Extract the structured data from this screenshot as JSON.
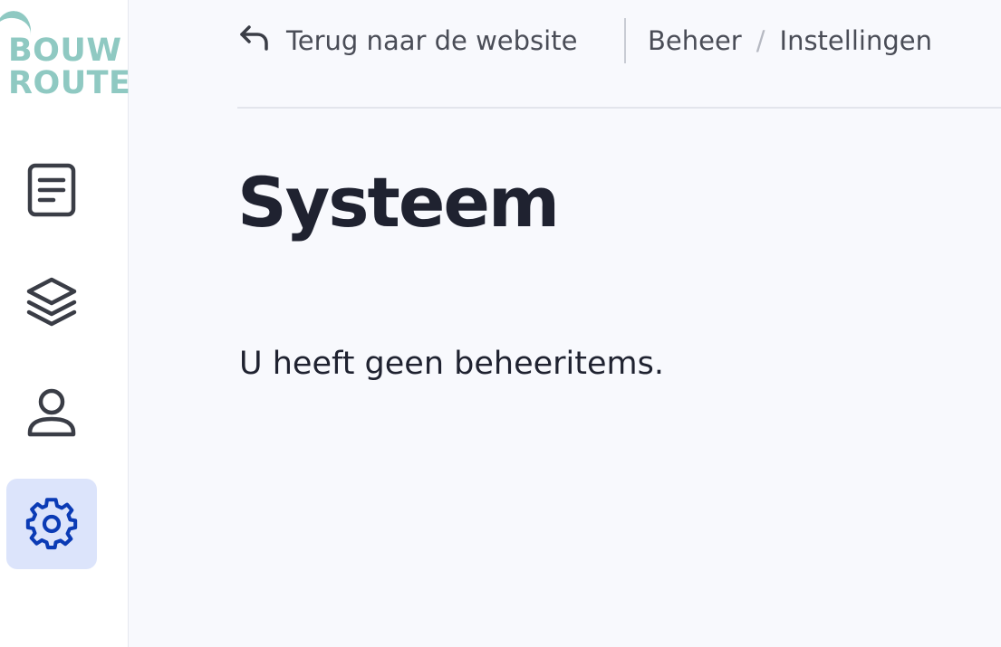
{
  "logo": {
    "line1": "BOUW",
    "line2": "ROUTE",
    "color": "#8fc9c2"
  },
  "sidebar": {
    "items": [
      {
        "icon": "document-icon",
        "active": false
      },
      {
        "icon": "layers-icon",
        "active": false
      },
      {
        "icon": "user-icon",
        "active": false
      },
      {
        "icon": "gear-icon",
        "active": true
      }
    ],
    "active_color": "#0b3bb5",
    "active_bg": "#dce4fb",
    "icon_color": "#3a3d46"
  },
  "topbar": {
    "back_label": "Terug naar de website",
    "breadcrumb": [
      "Beheer",
      "Instellingen"
    ],
    "separator": "/"
  },
  "main": {
    "title": "Systeem",
    "empty_message": "U heeft geen beheeritems."
  }
}
